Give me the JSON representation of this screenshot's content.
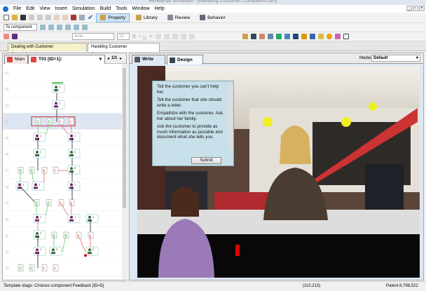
{
  "window": {
    "title": "Rehearsal Simulator - [Handling Customer Complaints.sim]"
  },
  "menu": [
    "File",
    "Edit",
    "View",
    "Insert",
    "Simulation",
    "Build",
    "Tools",
    "Window",
    "Help"
  ],
  "toolbar": {
    "property": "Property",
    "library": "Library",
    "review": "Review",
    "behavior": "Behavior",
    "align_select": "To component",
    "font": "Arial",
    "font_size": "10"
  },
  "doc_tabs": [
    "Dealing with Customer Complaints.sim",
    "Handling Customer Complaints.sim"
  ],
  "left": {
    "main_tab": "Main",
    "template": "T01 [ID=1]:",
    "page": "1/1",
    "rows": [
      "01",
      "02",
      "03",
      "04",
      "05",
      "06",
      "07",
      "08",
      "09",
      "10",
      "11",
      "12",
      "13"
    ]
  },
  "right": {
    "write_tab": "Write",
    "design_tab": "Design",
    "media_label": "Media",
    "media_value": "Default"
  },
  "choices": [
    "Tell the customer you can't help her.",
    "Tell the customer that she should write a letter.",
    "Empathize with the customer. Ask her about her family.",
    "Ask the customer to provide as much information as possible and document what she tells you."
  ],
  "submit": "Submit",
  "status": {
    "stage": "Template stage: Choices   component:Feedback [ID=5]",
    "coords": "(110,213)",
    "patent": "Patent 8,798,522"
  },
  "colors": {
    "accent": "#1a73c8",
    "choice_green": "#3cbf3c",
    "incorrect_red": "#e03030",
    "selected_row": "#dde6f2"
  }
}
